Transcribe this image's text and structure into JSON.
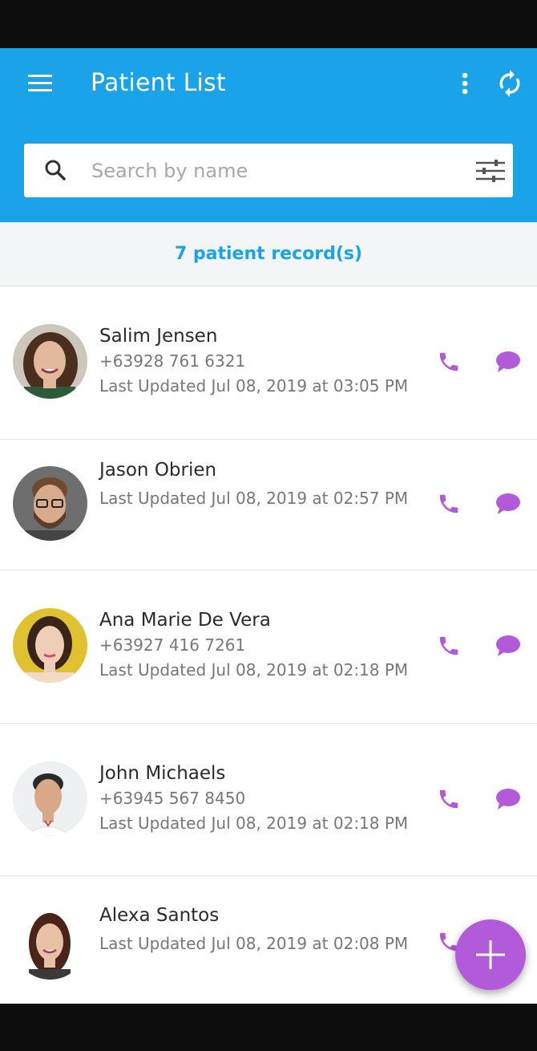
{
  "app_bar": {
    "title": "Patient List",
    "menu_icon": "hamburger-menu-icon",
    "more_icon": "more-vert-icon",
    "sync_icon": "sync-icon",
    "color": "#1aa3e8"
  },
  "search": {
    "placeholder": "Search by name",
    "value": "",
    "icon": "search-icon",
    "filter_icon": "filter-sliders-icon"
  },
  "summary": {
    "count_text": "7 patient record(s)"
  },
  "patients": [
    {
      "name": "Salim Jensen",
      "phone": "+63928 761 6321",
      "updated": "Last Updated Jul 08, 2019 at 03:05 PM"
    },
    {
      "name": "Jason Obrien",
      "phone": "",
      "updated": "Last Updated Jul 08, 2019 at 02:57 PM"
    },
    {
      "name": "Ana Marie De Vera",
      "phone": "+63927 416 7261",
      "updated": "Last Updated Jul 08, 2019 at 02:18 PM"
    },
    {
      "name": "John Michaels",
      "phone": "+63945 567 8450",
      "updated": "Last Updated Jul 08, 2019 at 02:18 PM"
    },
    {
      "name": "Alexa Santos",
      "phone": "",
      "updated": "Last Updated Jul 08, 2019 at 02:08 PM"
    }
  ],
  "actions": {
    "call_icon": "phone-icon",
    "message_icon": "chat-bubble-icon",
    "accent_color": "#b25ad9"
  },
  "fab": {
    "icon": "plus-icon"
  }
}
